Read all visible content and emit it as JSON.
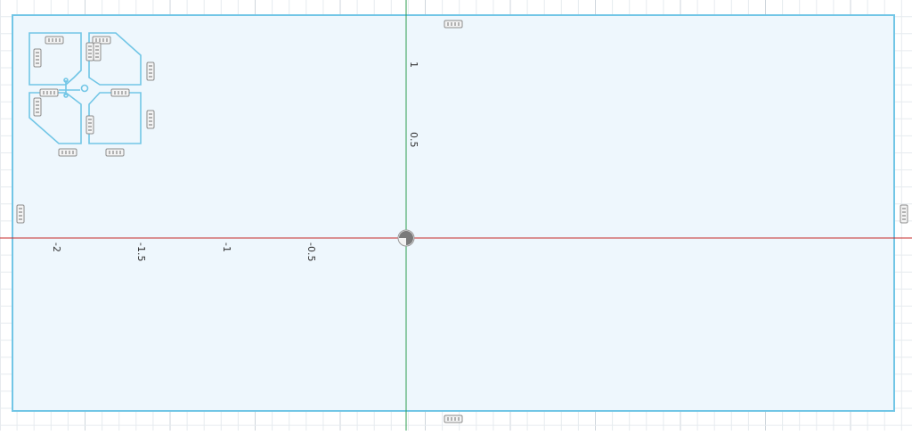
{
  "viewport": {
    "grid_visible": true,
    "colors": {
      "background": "#ffffff",
      "grid_minor": "#e6ebef",
      "grid_major": "#cfd6dc",
      "sketch_fill": "#eef7fd",
      "sketch_line": "#72c6e6",
      "x_axis": "#c62828",
      "y_axis": "#2e9e4f",
      "dimension_icon": "#8c8c8c"
    },
    "axis_labels": {
      "x": [
        "-2",
        "-1.5",
        "-1",
        "-0.5"
      ],
      "y": [
        "1",
        "0.5"
      ]
    },
    "icons": {
      "origin": "origin-marker-icon",
      "dimension": "dimension-constraint-icon"
    }
  }
}
